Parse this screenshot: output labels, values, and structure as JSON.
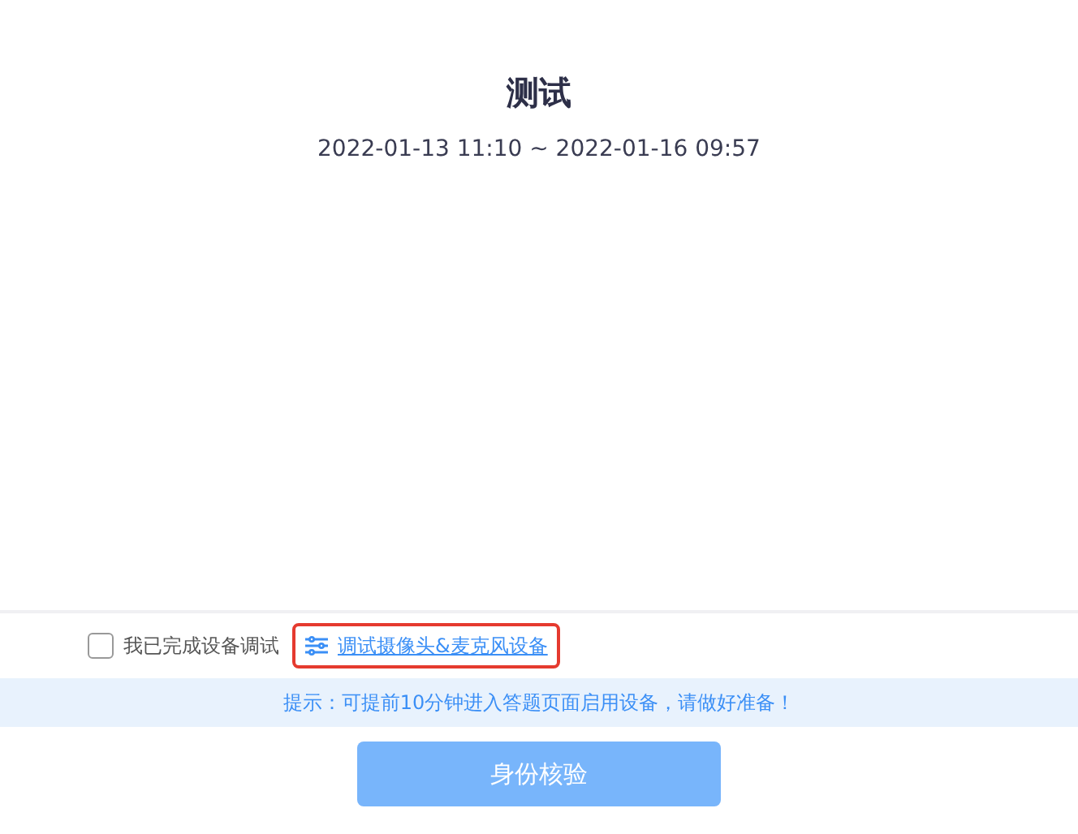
{
  "title": "测试",
  "time_range": "2022-01-13 11:10 ~ 2022-01-16 09:57",
  "confirm": {
    "label": "我已完成设备调试",
    "checked": false
  },
  "device_link": {
    "label": "调试摄像头&麦克风设备",
    "highlighted": true
  },
  "tip": "提示：可提前10分钟进入答题页面启用设备，请做好准备！",
  "verify_button": {
    "label": "身份核验",
    "disabled": true
  }
}
